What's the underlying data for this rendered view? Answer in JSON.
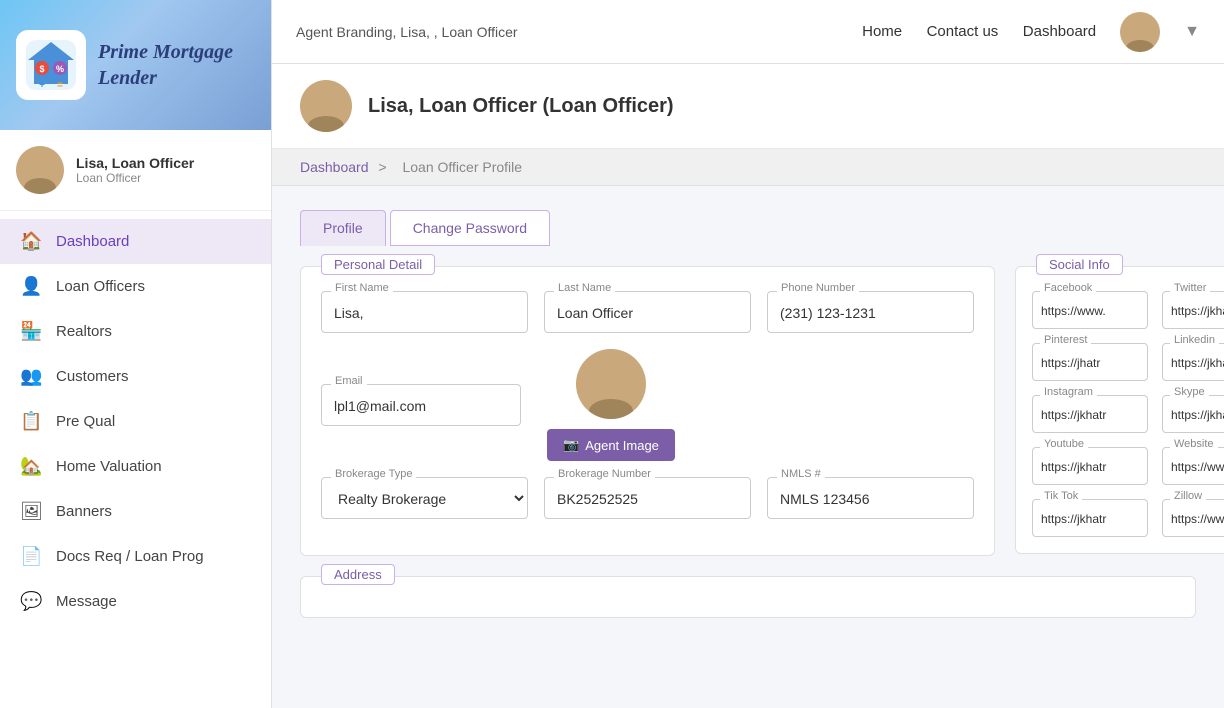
{
  "sidebar": {
    "logo_text": "Prime Mortgage Lender",
    "user_name": "Lisa, Loan Officer",
    "user_role": "Loan Officer",
    "nav_items": [
      {
        "label": "Dashboard",
        "icon": "🏠",
        "id": "dashboard"
      },
      {
        "label": "Loan Officers",
        "icon": "👤",
        "id": "loan-officers"
      },
      {
        "label": "Realtors",
        "icon": "🏪",
        "id": "realtors"
      },
      {
        "label": "Customers",
        "icon": "👥",
        "id": "customers"
      },
      {
        "label": "Pre Qual",
        "icon": "📋",
        "id": "pre-qual"
      },
      {
        "label": "Home Valuation",
        "icon": "🏡",
        "id": "home-valuation"
      },
      {
        "label": "Banners",
        "icon": "🖼",
        "id": "banners"
      },
      {
        "label": "Docs Req / Loan Prog",
        "icon": "📄",
        "id": "docs-req"
      },
      {
        "label": "Message",
        "icon": "💬",
        "id": "message"
      }
    ]
  },
  "topbar": {
    "breadcrumb_text": "Agent Branding, Lisa, , Loan Officer",
    "nav_links": [
      "Home",
      "Contact us",
      "Dashboard"
    ]
  },
  "page_header": {
    "title": "Lisa, Loan Officer (Loan Officer)"
  },
  "breadcrumb": {
    "link_text": "Dashboard",
    "separator": ">",
    "current": "Loan Officer Profile"
  },
  "tabs": [
    {
      "label": "Profile",
      "id": "profile",
      "active": true
    },
    {
      "label": "Change Password",
      "id": "change-password",
      "active": false
    }
  ],
  "personal_detail": {
    "section_label": "Personal Detail",
    "fields": {
      "first_name_label": "First Name",
      "first_name_value": "Lisa,",
      "last_name_label": "Last Name",
      "last_name_value": "Loan Officer",
      "phone_label": "Phone Number",
      "phone_value": "(231) 123-1231",
      "email_label": "Email",
      "email_value": "lpl1@mail.com",
      "brokerage_type_label": "Brokerage Type",
      "brokerage_type_value": "Realty Brokerage",
      "brokerage_number_label": "Brokerage Number",
      "brokerage_number_value": "BK25252525",
      "nmls_label": "NMLS #",
      "nmls_value": "NMLS 123456"
    },
    "agent_image_btn": "Agent Image"
  },
  "social_info": {
    "section_label": "Social Info",
    "fields": [
      {
        "label": "Facebook",
        "value": "https://www."
      },
      {
        "label": "Twitter",
        "value": "https://jkhati"
      },
      {
        "label": "Pinterest",
        "value": "https://jhatr"
      },
      {
        "label": "Linkedin",
        "value": "https://jkhati"
      },
      {
        "label": "Instagram",
        "value": "https://jkhatr"
      },
      {
        "label": "Skype",
        "value": "https://jkhat"
      },
      {
        "label": "Youtube",
        "value": "https://jkhatr"
      },
      {
        "label": "Website",
        "value": "https://www."
      },
      {
        "label": "Tik Tok",
        "value": "https://jkhatr"
      },
      {
        "label": "Zillow",
        "value": "https://www."
      }
    ]
  },
  "address": {
    "section_label": "Address"
  }
}
